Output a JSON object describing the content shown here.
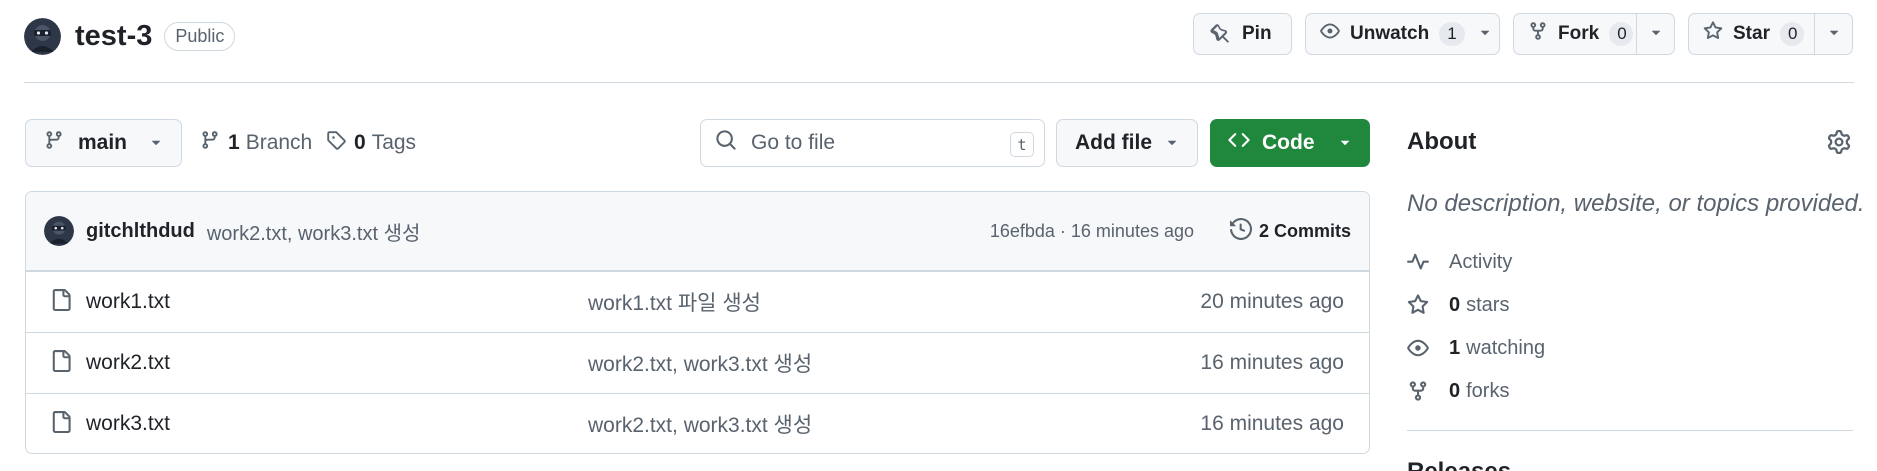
{
  "repo": {
    "name": "test-3",
    "visibility": "Public"
  },
  "actions": {
    "pin": "Pin",
    "unwatch": {
      "label": "Unwatch",
      "count": "1"
    },
    "fork": {
      "label": "Fork",
      "count": "0"
    },
    "star": {
      "label": "Star",
      "count": "0"
    }
  },
  "toolbar": {
    "branch": "main",
    "branches": {
      "count": "1",
      "label": "Branch"
    },
    "tags": {
      "count": "0",
      "label": "Tags"
    },
    "search_placeholder": "Go to file",
    "search_shortcut": "t",
    "add_file": "Add file",
    "code": "Code"
  },
  "latest_commit": {
    "author": "gitchlthdud",
    "message": "work2.txt, work3.txt 생성",
    "meta": "16efbda · 16 minutes ago",
    "commits": "2 Commits"
  },
  "files": [
    {
      "name": "work1.txt",
      "message": "work1.txt 파일 생성",
      "date": "20 minutes ago"
    },
    {
      "name": "work2.txt",
      "message": "work2.txt, work3.txt 생성",
      "date": "16 minutes ago"
    },
    {
      "name": "work3.txt",
      "message": "work2.txt, work3.txt 생성",
      "date": "16 minutes ago"
    }
  ],
  "about": {
    "title": "About",
    "description": "No description, website, or topics provided.",
    "activity": "Activity",
    "stars": {
      "count": "0",
      "label": "stars"
    },
    "watching": {
      "count": "1",
      "label": "watching"
    },
    "forks": {
      "count": "0",
      "label": "forks"
    },
    "releases_title": "Releases"
  },
  "colors": {
    "code_button": "#1f883d",
    "border": "#d1d9e0",
    "muted": "#59636e"
  }
}
